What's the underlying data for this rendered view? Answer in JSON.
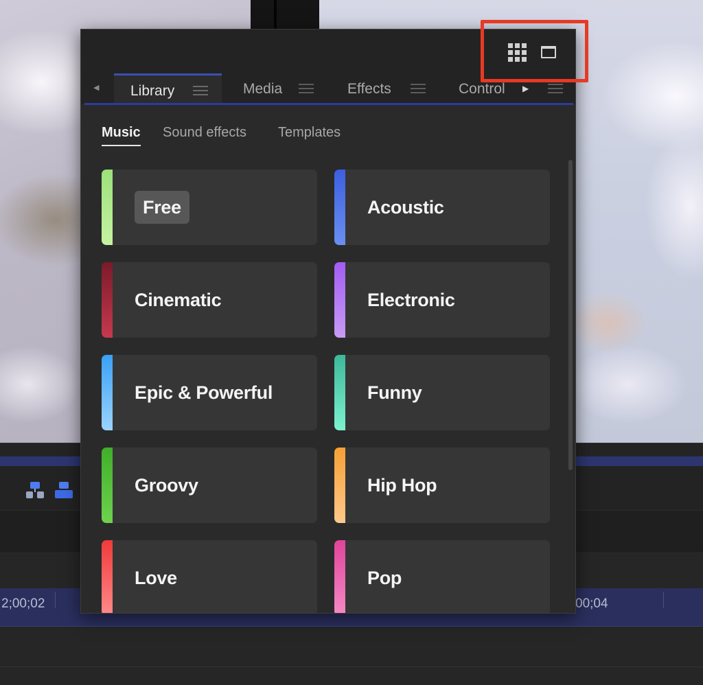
{
  "panel": {
    "view_toggle": {
      "grid_icon": "grid-view-icon",
      "window_icon": "window-view-icon"
    },
    "tabs": [
      {
        "label": "Library",
        "active": true
      },
      {
        "label": "Media",
        "active": false
      },
      {
        "label": "Effects",
        "active": false
      },
      {
        "label": "Control",
        "active": false
      }
    ],
    "subtabs": [
      {
        "label": "Music",
        "active": true
      },
      {
        "label": "Sound effects",
        "active": false
      },
      {
        "label": "Templates",
        "active": false
      }
    ],
    "categories": [
      {
        "label": "Free",
        "colors": [
          "#9be07a",
          "#c6f2a3"
        ]
      },
      {
        "label": "Acoustic",
        "colors": [
          "#3c5fe0",
          "#6a8ff0"
        ]
      },
      {
        "label": "Cinematic",
        "colors": [
          "#7a1a2a",
          "#c6394f"
        ]
      },
      {
        "label": "Electronic",
        "colors": [
          "#a35cf2",
          "#c79bf5"
        ]
      },
      {
        "label": "Epic & Powerful",
        "colors": [
          "#3aa0f5",
          "#9bd4ff"
        ]
      },
      {
        "label": "Funny",
        "colors": [
          "#3db89a",
          "#7df2cf"
        ]
      },
      {
        "label": "Groovy",
        "colors": [
          "#3fae2a",
          "#6fd24e"
        ]
      },
      {
        "label": "Hip Hop",
        "colors": [
          "#f5a035",
          "#ffc88a"
        ]
      },
      {
        "label": "Love",
        "colors": [
          "#f03a3a",
          "#ff8a8a"
        ]
      },
      {
        "label": "Pop",
        "colors": [
          "#e0449a",
          "#f58ac4"
        ]
      }
    ]
  },
  "timeline": {
    "timecode_left": "2;00;02",
    "timecode_right": "00;04"
  },
  "colors": {
    "highlight": "#e63a25",
    "accent_blue": "#2d3b9e",
    "panel_bg": "#2a2a2a",
    "card_bg": "#363636"
  }
}
